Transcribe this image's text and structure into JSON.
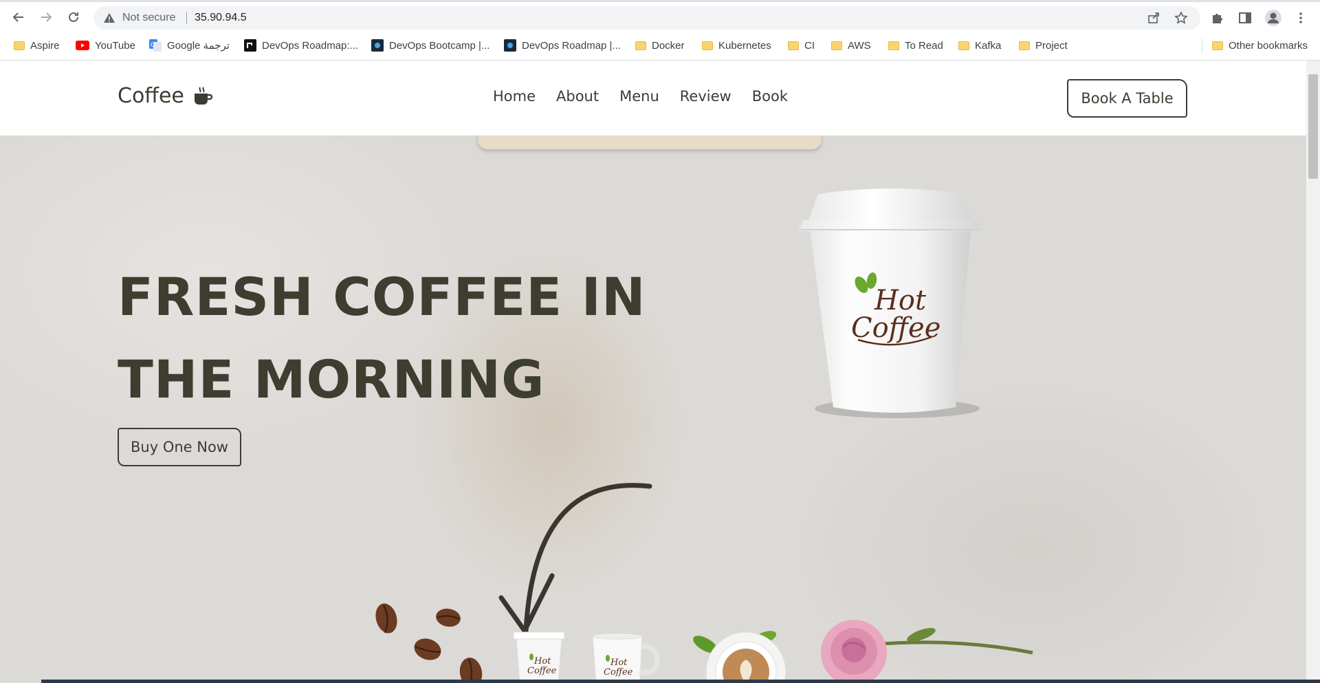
{
  "browser": {
    "address_warning": "Not secure",
    "url": "35.90.94.5",
    "bookmarks": [
      {
        "label": "Aspire",
        "icon": "folder-icon"
      },
      {
        "label": "YouTube",
        "icon": "youtube-icon"
      },
      {
        "label": "Google ترجمة",
        "icon": "google-translate-icon"
      },
      {
        "label": "DevOps Roadmap:...",
        "icon": "roadmap-icon"
      },
      {
        "label": "DevOps Bootcamp |...",
        "icon": "bootcamp-icon"
      },
      {
        "label": "DevOps Roadmap |...",
        "icon": "bootcamp-icon"
      },
      {
        "label": "Docker",
        "icon": "folder-icon"
      },
      {
        "label": "Kubernetes",
        "icon": "folder-icon"
      },
      {
        "label": "CI",
        "icon": "folder-icon"
      },
      {
        "label": "AWS",
        "icon": "folder-icon"
      },
      {
        "label": "To Read",
        "icon": "folder-icon"
      },
      {
        "label": "Kafka",
        "icon": "folder-icon"
      },
      {
        "label": "Project",
        "icon": "folder-icon"
      }
    ],
    "other_bookmarks": "Other bookmarks"
  },
  "site": {
    "logo": "Coffee",
    "nav": [
      "Home",
      "About",
      "Menu",
      "Review",
      "Book"
    ],
    "cta": "Book A Table",
    "hero": {
      "title_line1": "FRESH COFFEE IN",
      "title_line2": "THE MORNING",
      "button": "Buy One Now",
      "cup_logo_line1": "Hot",
      "cup_logo_line2": "Coffee"
    }
  },
  "colors": {
    "text_dark": "#3c3c33",
    "hero_bg": "#dcdad6",
    "cup_logo_brown": "#5a2f1c",
    "leaf_green": "#6aa82e"
  }
}
